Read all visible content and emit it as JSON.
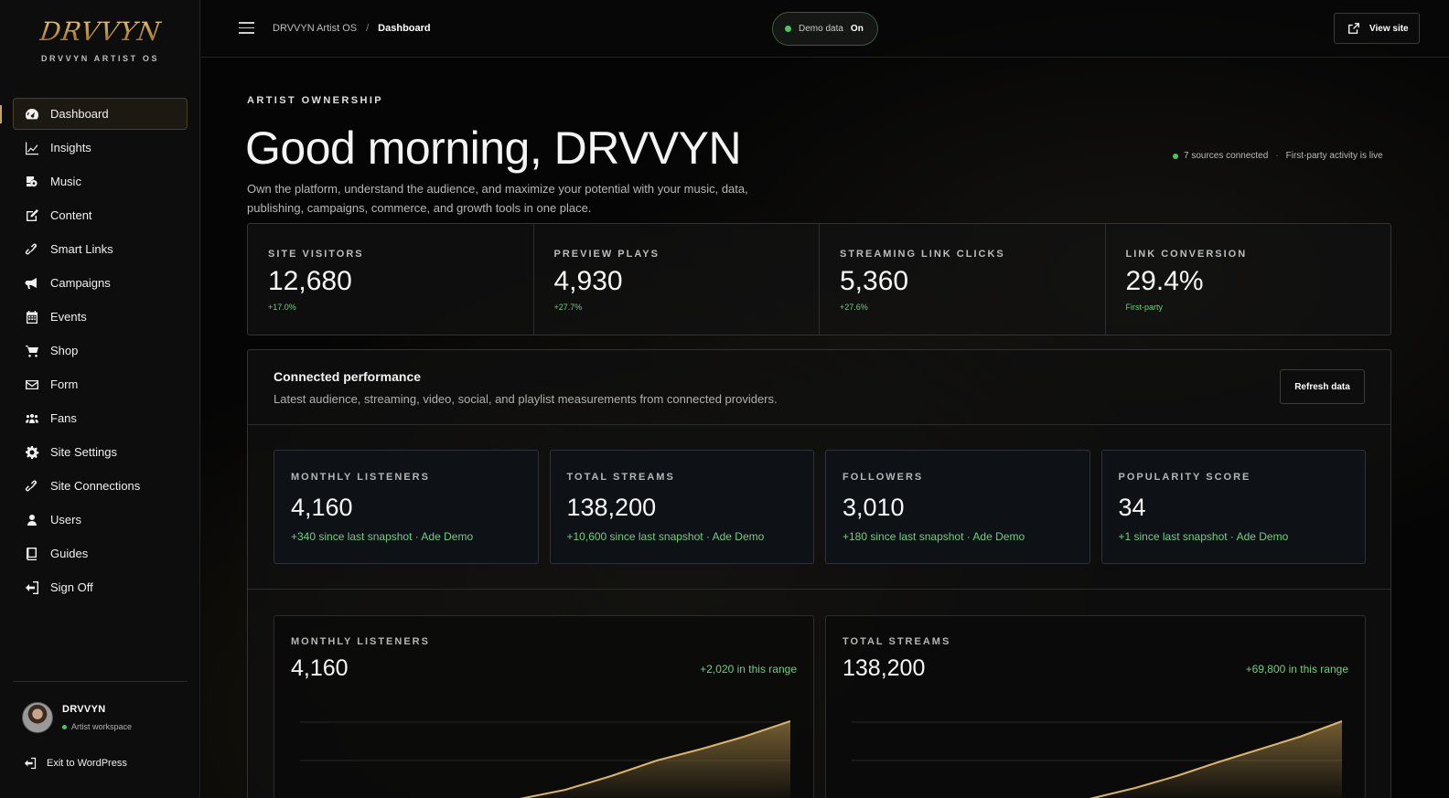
{
  "brand": {
    "logo": "DRVVYN",
    "subtitle": "DRVVYN ARTIST OS"
  },
  "sidebar": {
    "items": [
      {
        "label": "Dashboard",
        "icon": "dashboard-icon",
        "active": true
      },
      {
        "label": "Insights",
        "icon": "insights-icon"
      },
      {
        "label": "Music",
        "icon": "music-icon"
      },
      {
        "label": "Content",
        "icon": "content-icon"
      },
      {
        "label": "Smart Links",
        "icon": "link-icon"
      },
      {
        "label": "Campaigns",
        "icon": "megaphone-icon"
      },
      {
        "label": "Events",
        "icon": "calendar-icon"
      },
      {
        "label": "Shop",
        "icon": "cart-icon"
      },
      {
        "label": "Form",
        "icon": "mail-icon"
      },
      {
        "label": "Fans",
        "icon": "users-icon"
      },
      {
        "label": "Site Settings",
        "icon": "gear-icon"
      },
      {
        "label": "Site Connections",
        "icon": "link-icon"
      },
      {
        "label": "Users",
        "icon": "user-icon"
      },
      {
        "label": "Guides",
        "icon": "book-icon"
      },
      {
        "label": "Sign Off",
        "icon": "sign-out-icon"
      }
    ],
    "user": {
      "name": "DRVVYN",
      "role": "Artist workspace"
    },
    "exit_label": "Exit to WordPress"
  },
  "topbar": {
    "breadcrumb_root": "DRVVYN Artist OS",
    "breadcrumb_sep": "/",
    "breadcrumb_current": "Dashboard",
    "demo_label": "Demo data",
    "demo_state": "On",
    "view_site_label": "View site"
  },
  "hero": {
    "eyebrow": "ARTIST OWNERSHIP",
    "greeting": "Good morning, DRVVYN",
    "intro": "Own the platform, understand the audience, and maximize your potential with your music, data, publishing, campaigns, commerce, and growth tools in one place.",
    "sources": "7 sources connected",
    "status_sep": "·",
    "activity": "First-party activity is live"
  },
  "kpis": [
    {
      "label": "SITE VISITORS",
      "value": "12,680",
      "delta": "+17.0%"
    },
    {
      "label": "PREVIEW PLAYS",
      "value": "4,930",
      "delta": "+27.7%"
    },
    {
      "label": "STREAMING LINK CLICKS",
      "value": "5,360",
      "delta": "+27.6%"
    },
    {
      "label": "LINK CONVERSION",
      "value": "29.4%",
      "delta": "First-party"
    }
  ],
  "performance": {
    "title": "Connected performance",
    "subtitle": "Latest audience, streaming, video, social, and playlist measurements from connected providers.",
    "refresh_label": "Refresh data",
    "metrics": [
      {
        "label": "MONTHLY LISTENERS",
        "value": "4,160",
        "delta": "+340 since last snapshot · Ade Demo"
      },
      {
        "label": "TOTAL STREAMS",
        "value": "138,200",
        "delta": "+10,600 since last snapshot · Ade Demo"
      },
      {
        "label": "FOLLOWERS",
        "value": "3,010",
        "delta": "+180 since last snapshot · Ade Demo"
      },
      {
        "label": "POPULARITY SCORE",
        "value": "34",
        "delta": "+1 since last snapshot · Ade Demo"
      }
    ],
    "charts": [
      {
        "label": "MONTHLY LISTENERS",
        "value": "4,160",
        "range_delta": "+2,020 in this range"
      },
      {
        "label": "TOTAL STREAMS",
        "value": "138,200",
        "range_delta": "+69,800 in this range"
      }
    ]
  },
  "colors": {
    "accent": "#c9a55c",
    "positive": "#6fce7f",
    "status_green": "#4cc36b"
  }
}
